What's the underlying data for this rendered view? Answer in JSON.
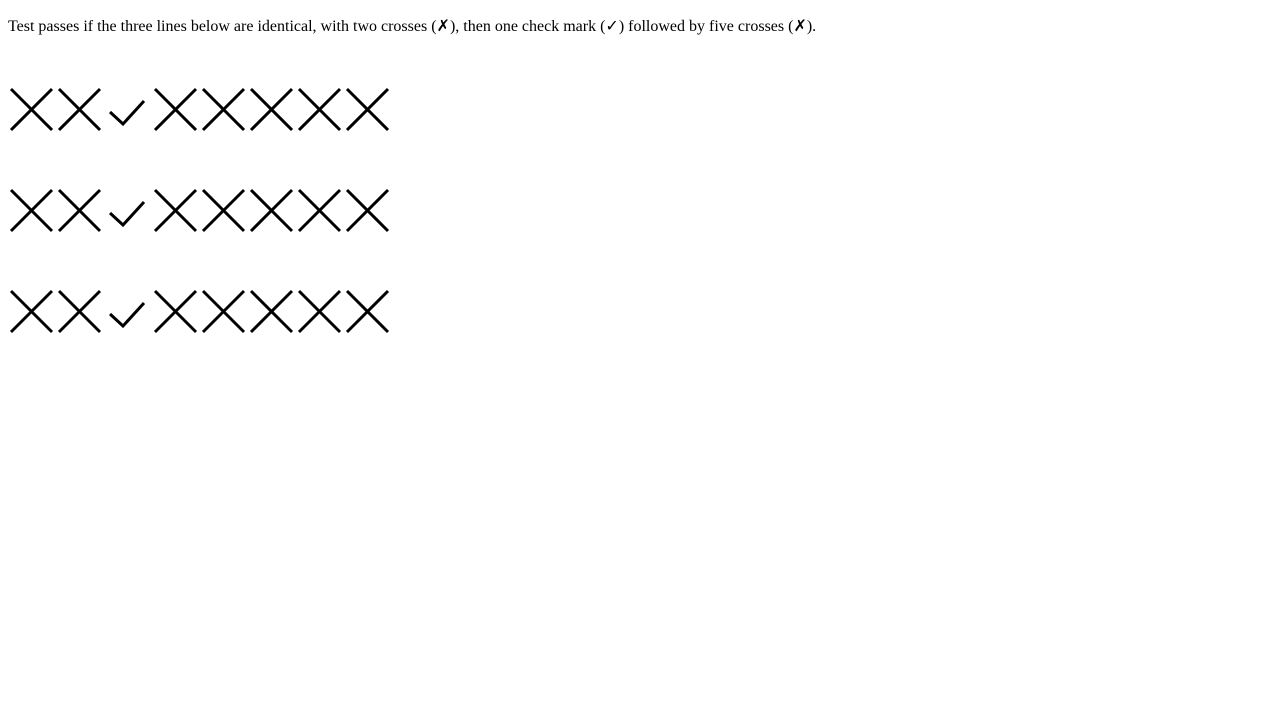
{
  "description": "Test passes if the three lines below are identical, with two crosses (✗), then one check mark (✓) followed by five crosses (✗).",
  "rows": [
    [
      "cross",
      "cross",
      "check",
      "cross",
      "cross",
      "cross",
      "cross",
      "cross"
    ],
    [
      "cross",
      "cross",
      "check",
      "cross",
      "cross",
      "cross",
      "cross",
      "cross"
    ],
    [
      "cross",
      "cross",
      "check",
      "cross",
      "cross",
      "cross",
      "cross",
      "cross"
    ]
  ],
  "colors": {
    "mark": "#000000",
    "background": "#ffffff"
  }
}
